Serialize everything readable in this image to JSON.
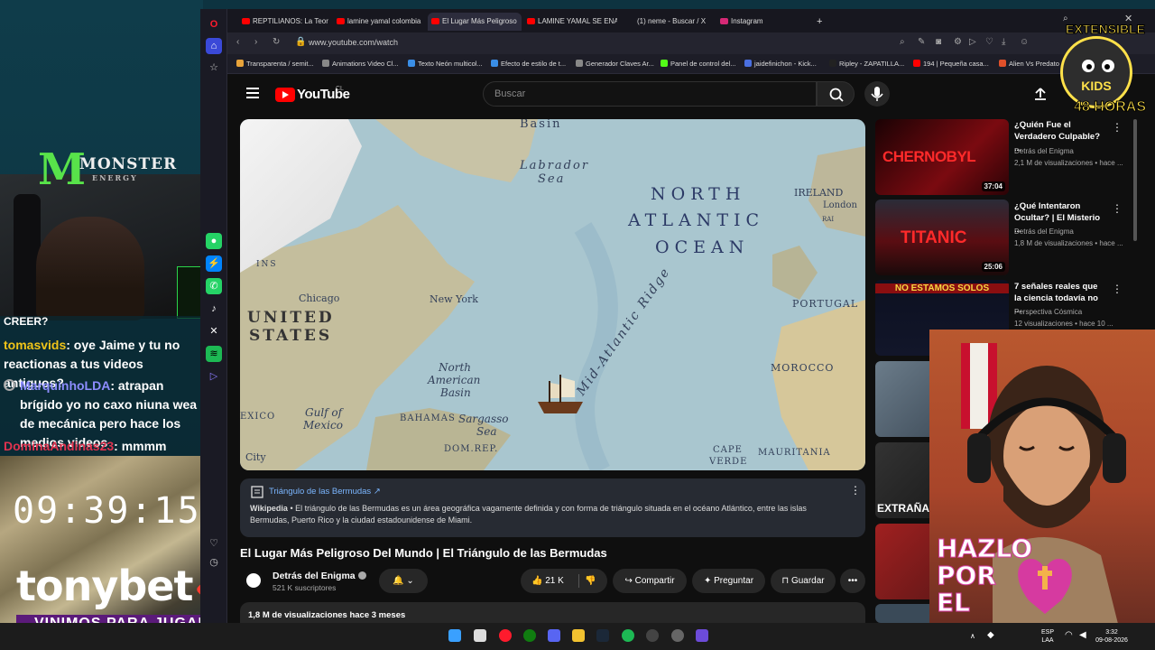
{
  "stream": {
    "brand": {
      "letter": "M",
      "word": "MONSTER",
      "sub": "ENERGY"
    },
    "chat": [
      {
        "user": "",
        "text": "CREER?"
      },
      {
        "user": "tomasvids",
        "text": ": oye Jaime y tu no reactionas a tus videos antiguos?"
      },
      {
        "user": "MarquinhoLDA",
        "text": ": atrapan brígido yo no caxo niuna wea de mecánica pero hace los medios videos"
      },
      {
        "user": "DominaAndinas23",
        "text": ": mmmm"
      }
    ],
    "clock": "09:39:15",
    "sponsor": "tonybet",
    "slogan": "VINIMOS PARA JUGAR",
    "badge": {
      "top": "EXTENSIBLE",
      "middle": "KIDS",
      "bottom": "48 HORAS"
    },
    "overlay_text": [
      "HAZLO",
      "POR",
      "EL"
    ]
  },
  "browser": {
    "tabs": [
      "REPTILIANOS: La Teoría C",
      "lamine yamal colombia - Y",
      "El Lugar Más Peligroso",
      "LAMINE YAMAL SE ENAM",
      "(1) neme - Buscar / X",
      "Instagram"
    ],
    "new_tab": "+",
    "url": "www.youtube.com/watch",
    "bookmarks": [
      "Transparenta / semit...",
      "Animations Video Cl...",
      "Texto Neón multicol...",
      "Efecto de estilo de t...",
      "Generador Claves Ar...",
      "Panel de control del...",
      "jaidefinichon - Kick...",
      "Ripley - ZAPATILLA...",
      "194 | Pequeña casa...",
      "Alien Vs Predato"
    ]
  },
  "youtube": {
    "logo": "YouTube",
    "country": "CL",
    "search_placeholder": "Buscar",
    "map_labels": {
      "north": "NORTH",
      "atlantic": "ATLANTIC",
      "ocean": "OCEAN",
      "labrador": "Labrador",
      "sea": "Sea",
      "basin": "Basin",
      "ireland": "IRELAND",
      "london": "London",
      "united": "UNITED",
      "states": "STATES",
      "chicago": "Chicago",
      "newyork": "New York",
      "portugal": "PORTUGAL",
      "morocco": "MOROCCO",
      "ridge": "Mid-Atlantic Ridge",
      "na_basin1": "North",
      "na_basin2": "American",
      "na_basin3": "Basin",
      "gulf1": "Gulf of",
      "gulf2": "Mexico",
      "mexico": "EXICO",
      "bahamas": "BAHAMAS",
      "sargasso1": "Sargasso",
      "sargasso2": "Sea",
      "domrep": "DOM.REP.",
      "city": "City",
      "mauritania": "MAURITANIA",
      "cape1": "CAPE",
      "cape2": "VERDE",
      "mins": "INS",
      "rai": "RAI"
    },
    "info_card": {
      "title": "Triángulo de las Bermudas ↗",
      "source": "Wikipedia",
      "text": " • El triángulo de las Bermudas es un área geográfica vagamente definida y con forma de triángulo situada en el océano Atlántico, entre las islas Bermudas, Puerto Rico y la ciudad estadounidense de Miami."
    },
    "video_title": "El Lugar Más Peligroso Del Mundo | El Triángulo de las Bermudas",
    "channel": {
      "name": "Detrás del Enigma",
      "subs": "521 K suscriptores"
    },
    "actions": {
      "likes": "21 K",
      "share": "Compartir",
      "ask": "Preguntar",
      "save": "Guardar",
      "more": "•••"
    },
    "desc_stats": "1,8 M de visualizaciones  hace 3 meses",
    "recommended": [
      {
        "title": "¿Quién Fue el Verdadero Culpable? ...",
        "channel": "Detrás del Enigma",
        "meta": "2,1 M de visualizaciones • hace ...",
        "duration": "37:04",
        "thumb_text": "CHERNOBYL",
        "color": "#7a0a10"
      },
      {
        "title": "¿Qué Intentaron Ocultar? | El Misterio ...",
        "channel": "Detrás del Enigma",
        "meta": "1,8 M de visualizaciones • hace ...",
        "duration": "25:06",
        "thumb_text": "TITANIC",
        "color": "#5a0d12"
      },
      {
        "title": "7 señales reales que la ciencia todavía no ...",
        "channel": "Perspectiva Cósmica",
        "meta": "12 visualizaciones • hace 10 ...",
        "duration": "",
        "thumb_text": "NO ESTAMOS SOLOS",
        "color": "#12162a"
      },
      {
        "title": "",
        "channel": "",
        "meta": "",
        "duration": "",
        "thumb_text": "",
        "color": "#2f3b48"
      },
      {
        "title": "",
        "channel": "",
        "meta": "",
        "duration": "",
        "thumb_text": "EXTRAÑAS D",
        "color": "#1b1b1b"
      },
      {
        "title": "",
        "channel": "",
        "meta": "",
        "duration": "",
        "thumb_text": "",
        "color": "#4a1414"
      }
    ]
  },
  "taskbar": {
    "lang1": "ESP",
    "lang2": "LAA",
    "time": "3:32",
    "date": "09-08-2026"
  },
  "colors": {
    "yt_red": "#ff0000",
    "accent_blue": "#3ea6ff",
    "monster_green": "#58e34a"
  }
}
